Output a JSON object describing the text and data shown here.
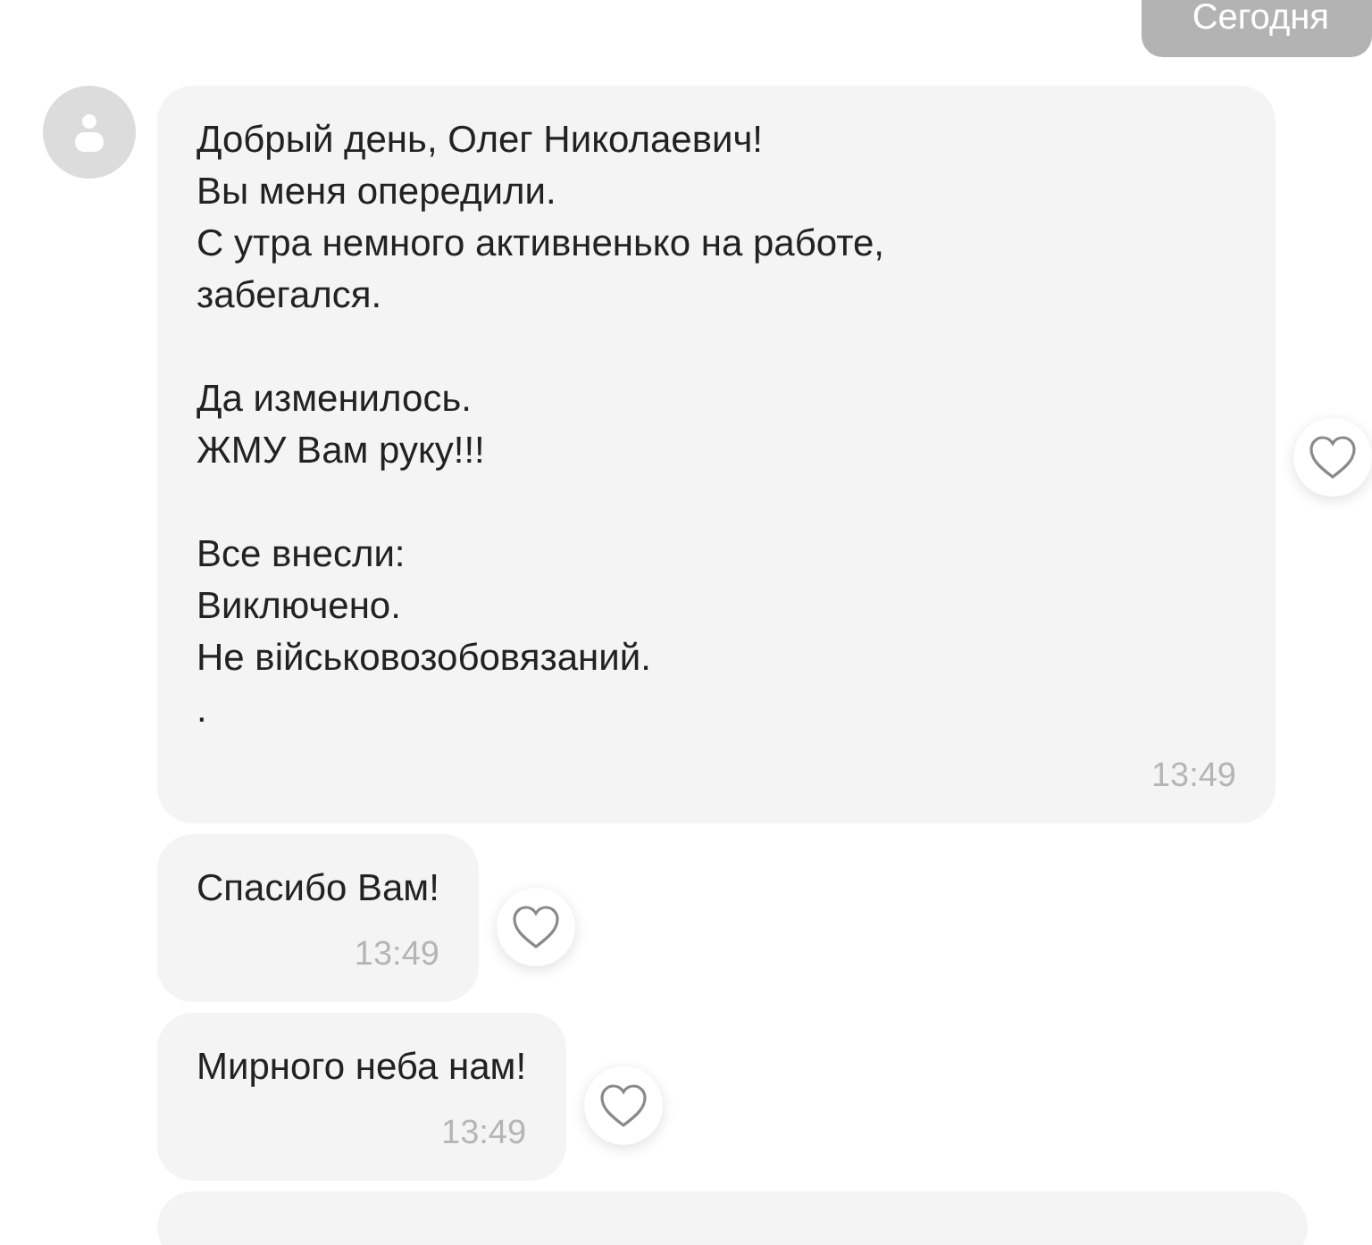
{
  "date_label": "Сегодня",
  "messages": [
    {
      "kind": "text",
      "avatar": true,
      "paragraphs": [
        [
          "Добрый день, Олег Николаевич!",
          "Вы меня опередили.",
          "С утра немного активненько на работе,",
          "забегался."
        ],
        [
          "Да изменилось.",
          "ЖМУ Вам руку!!!"
        ],
        [
          "Все внесли:",
          "Виключено.",
          "Не військовозобовязаний.",
          "."
        ]
      ],
      "time": "13:49"
    },
    {
      "kind": "text",
      "avatar": false,
      "paragraphs": [
        [
          "Спасибо Вам!"
        ]
      ],
      "time": "13:49"
    },
    {
      "kind": "text",
      "avatar": false,
      "paragraphs": [
        [
          "Мирного неба нам!"
        ]
      ],
      "time": "13:49"
    },
    {
      "kind": "partial"
    }
  ]
}
